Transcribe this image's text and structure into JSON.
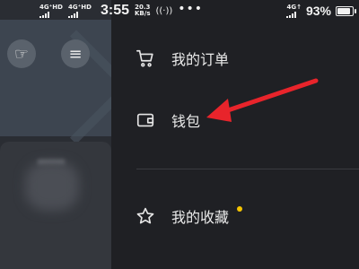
{
  "status_bar": {
    "network_1": "4G⁺HD",
    "network_2": "4G⁺HD",
    "time": "3:55",
    "speed_value": "20.3",
    "speed_unit": "KB/s",
    "network_3": "4G↑",
    "battery": "93%",
    "battery_level": 0.93
  },
  "drawer": {
    "items": [
      {
        "label": "我的订单",
        "icon": "cart-icon"
      },
      {
        "label": "钱包",
        "icon": "wallet-icon"
      },
      {
        "label": "我的收藏",
        "icon": "star-icon",
        "badge_color": "#f5c400"
      }
    ]
  },
  "left_page": {
    "icons": [
      "hand-pointer-icon",
      "menu-icon"
    ]
  },
  "annotation": {
    "arrow_color": "#e8242b"
  }
}
